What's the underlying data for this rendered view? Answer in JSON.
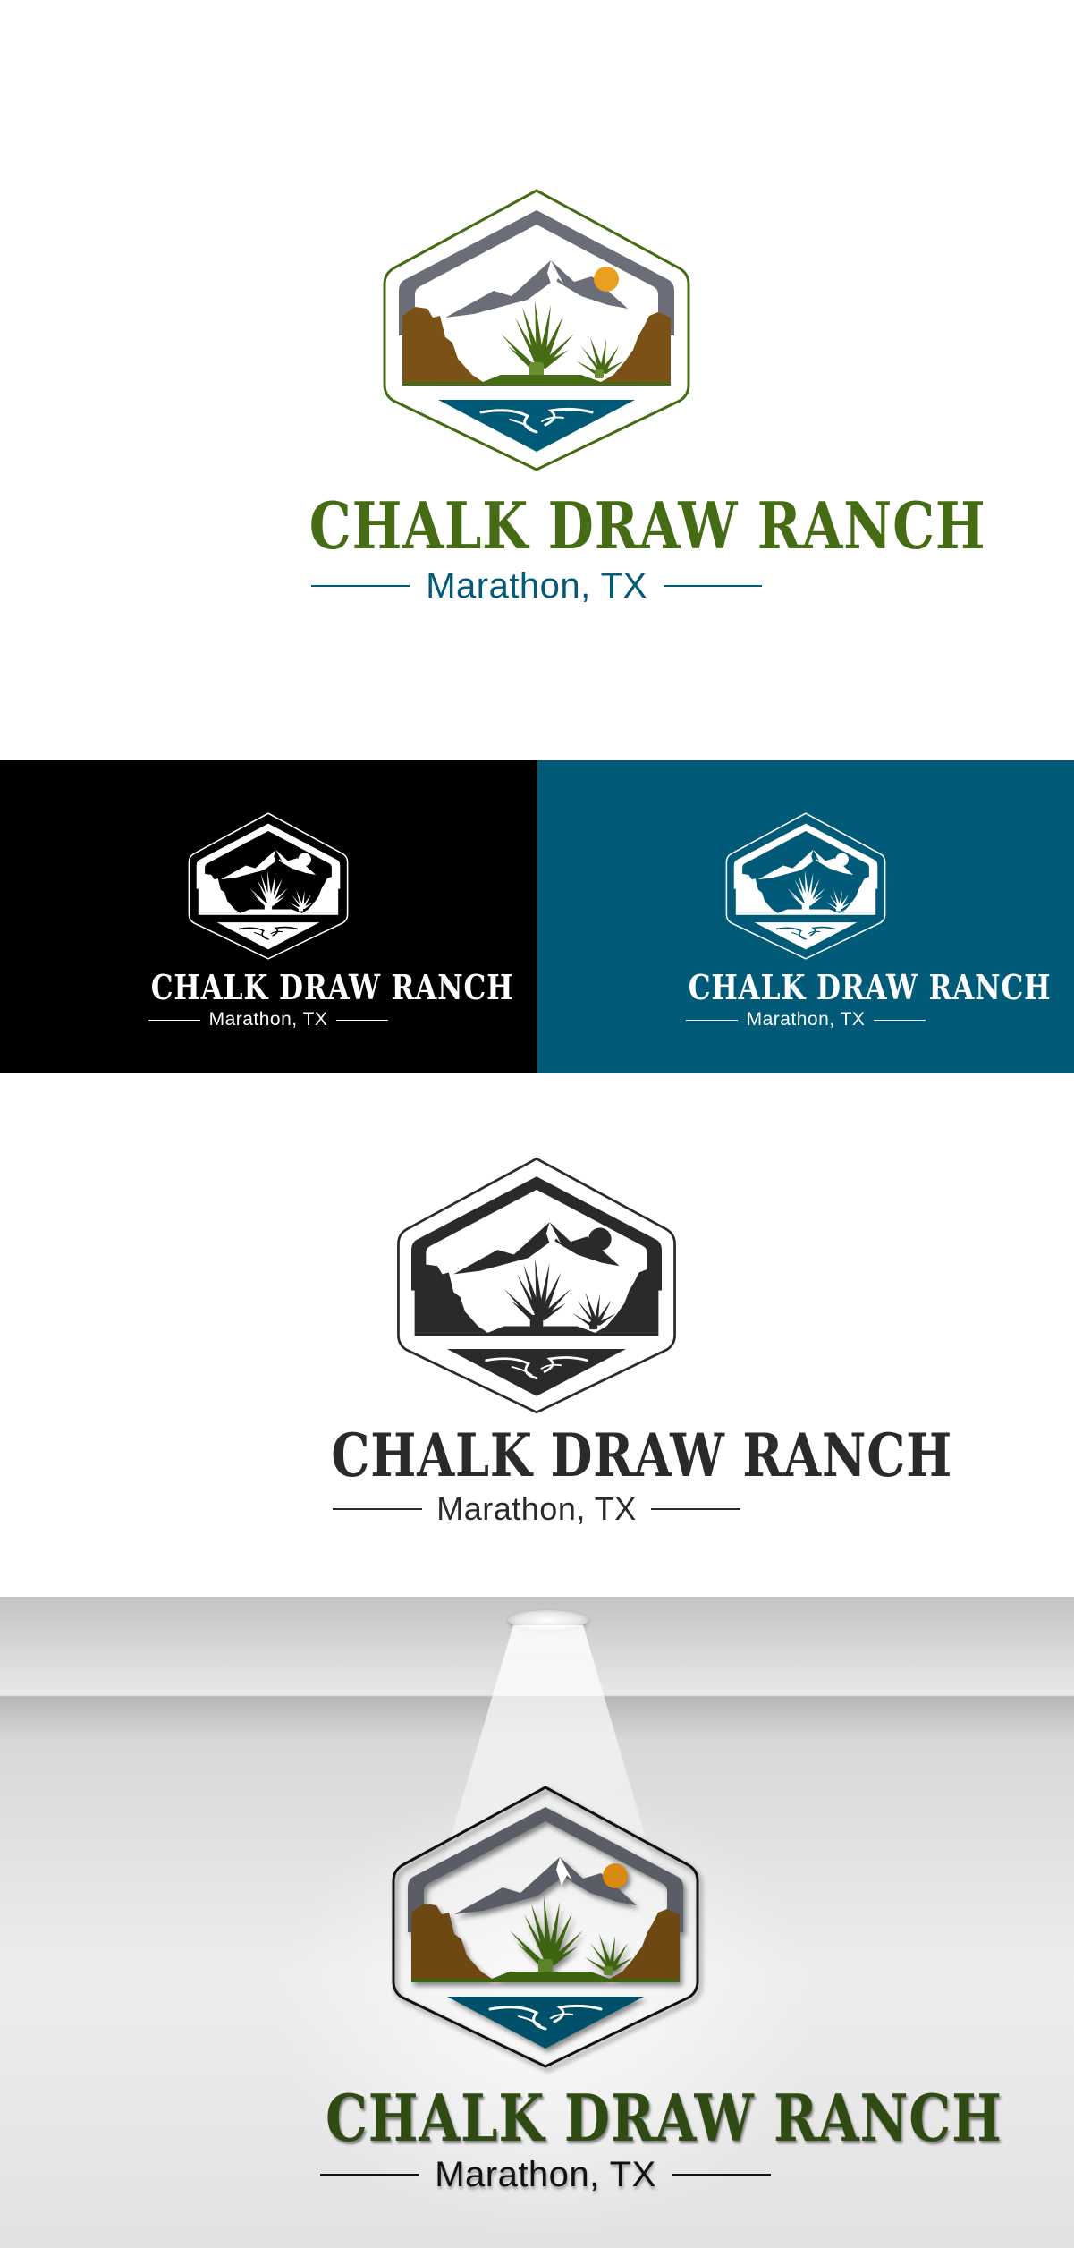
{
  "brand": {
    "name": "CHALK DRAW RANCH",
    "location": "Marathon, TX"
  },
  "colors": {
    "green": "#456c14",
    "blue": "#005a78",
    "gray": "#6b6e78",
    "brown": "#7a5215",
    "orange": "#e8a01e",
    "black": "#000000",
    "white": "#ffffff",
    "charcoal": "#2a2a2a",
    "panel_teal": "#005a78",
    "panel_black": "#000000"
  },
  "variants": [
    "full-color",
    "white-on-black",
    "white-on-teal",
    "monochrome",
    "wall-mockup"
  ]
}
